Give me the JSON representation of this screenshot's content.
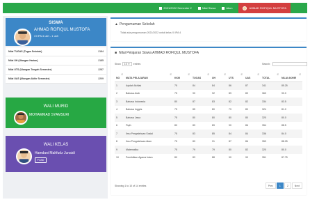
{
  "topnav": {
    "items": [
      {
        "label": "2021/2022 Semester 2",
        "icon": "calendar-icon"
      },
      {
        "label": "Nilai Siswa",
        "icon": "document-icon"
      },
      {
        "label": "Akun",
        "icon": "user-icon"
      }
    ],
    "user_name": "AHMAD ROFIQUL MUSTOFA"
  },
  "siswa_card": {
    "title": "SISWA",
    "name": "AHMAD ROFIQUL MUSTOFA",
    "kelas": "XI IPA 4 ukh - 1 ukh"
  },
  "stats": [
    {
      "label": "Nilai TUGAS (Tugas Sekolah)",
      "value": "2184"
    },
    {
      "label": "Nilai UH (Ulangan Harian)",
      "value": "2185"
    },
    {
      "label": "Nilai UTS (Ulangan Tengah Semester)",
      "value": "2287"
    },
    {
      "label": "Nilai UAS (Ulangan Akhir Semester)",
      "value": "2209"
    }
  ],
  "wali_murid": {
    "title": "WALI MURID",
    "name": "MOHAMMAD SYAMSURI"
  },
  "wali_kelas": {
    "title": "WALI KELAS",
    "name": "Hamdani Mahfudz Junaidi",
    "button_label": "Profile"
  },
  "pengumuman": {
    "title": "Pengumuman Sekolah",
    "body": "Tidak ada pengumuman 2021/2022 untuk kelas XI IPA 4"
  },
  "nilai": {
    "title": "Nilai Pelajaran Siswa AHMAD ROFIQUL MUSTOFA",
    "show_label": "Show",
    "show_value": "10",
    "entries_label": "entries",
    "search_label": "Search:",
    "columns": [
      "NO",
      "MATA PELAJARAN",
      "KKM",
      "TUGAS",
      "UH",
      "UTS",
      "UAS",
      "TOTAL",
      "NILAI AKHIR"
    ],
    "rows": [
      [
        "1",
        "Aqidah Akhlak",
        "75",
        "84",
        "84",
        "86",
        "87",
        "341",
        "85.25"
      ],
      [
        "2",
        "Bahasa Arab",
        "75",
        "90",
        "92",
        "89",
        "89",
        "360",
        "90.0"
      ],
      [
        "3",
        "Bahasa Indonesia",
        "80",
        "87",
        "83",
        "82",
        "82",
        "334",
        "83.5"
      ],
      [
        "4",
        "Bahasa Inggris",
        "75",
        "85",
        "80",
        "79",
        "80",
        "324",
        "81.0"
      ],
      [
        "5",
        "Bahasa Jawa",
        "75",
        "80",
        "80",
        "80",
        "80",
        "320",
        "80.0"
      ],
      [
        "6",
        "Fiqih",
        "80",
        "89",
        "89",
        "90",
        "86",
        "354",
        "88.5"
      ],
      [
        "7",
        "Ilmu Pengetahuan Sosial",
        "75",
        "83",
        "85",
        "84",
        "84",
        "336",
        "84.0"
      ],
      [
        "8",
        "Ilmu Pengetahuan Alam",
        "75",
        "89",
        "91",
        "87",
        "86",
        "353",
        "88.25"
      ],
      [
        "9",
        "Matematika",
        "75",
        "79",
        "79",
        "80",
        "82",
        "320",
        "80.0"
      ],
      [
        "10",
        "Pendidikan Agama Islam",
        "80",
        "83",
        "88",
        "90",
        "90",
        "351",
        "87.75"
      ]
    ],
    "info": "Showing 1 to 10 of 14 entries",
    "pager": [
      "Prev",
      "1",
      "2",
      "Next"
    ],
    "active_page": "1"
  }
}
